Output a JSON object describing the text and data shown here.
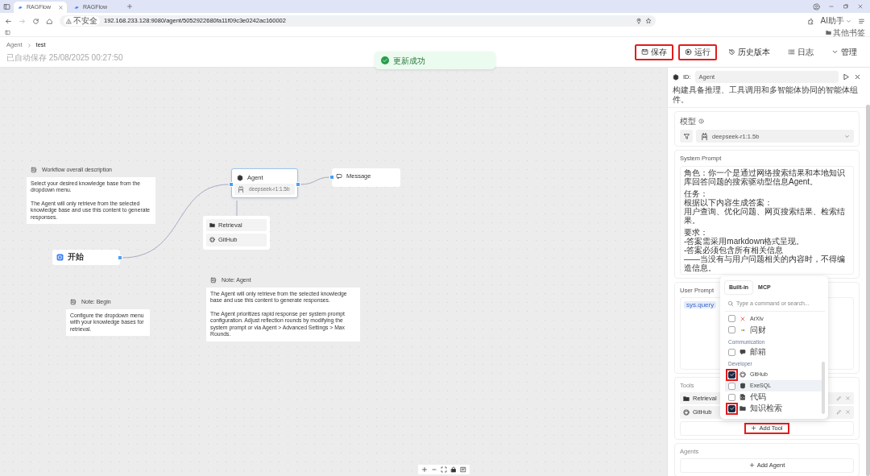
{
  "browser": {
    "tabs": [
      {
        "title": "RAGFlow",
        "selected": true
      },
      {
        "title": "RAGFlow",
        "selected": false
      }
    ],
    "security": "不安全",
    "url": "192.168.233.128:9080/agent/5052922680fa11f09c3e0242ac160002",
    "assistant": "AI助手",
    "bookmarks_folder": "其他书签"
  },
  "header": {
    "breadcrumb": [
      "Agent",
      "test"
    ],
    "saved": "已自动保存 25/08/2025 00:27:50",
    "actions": [
      {
        "label": "保存",
        "highlighted": true
      },
      {
        "label": "运行",
        "highlighted": true
      },
      {
        "label": "历史版本",
        "highlighted": false
      },
      {
        "label": "日志",
        "highlighted": false
      },
      {
        "label": "管理",
        "highlighted": false
      }
    ]
  },
  "toast": {
    "text": "更新成功"
  },
  "canvas": {
    "nodes": [
      {
        "kind": "note",
        "title": "Workflow overall description",
        "paragraphs": [
          "Select your desired knowledge base from the dropdown menu.",
          "The Agent will only retrieve from the selected knowledge base and use this content  to generate responses."
        ]
      },
      {
        "kind": "agent",
        "title": "Agent",
        "model": "deepseek-r1:1.5b"
      },
      {
        "kind": "message",
        "title": "Message"
      },
      {
        "kind": "tools",
        "items": [
          {
            "name": "Retrieval"
          },
          {
            "name": "GitHub"
          }
        ]
      },
      {
        "kind": "begin",
        "title": "开始"
      },
      {
        "kind": "note",
        "title": "Note: Agent",
        "paragraphs": [
          "The Agent will only retrieve from the selected knowledge base and use this content  to generate responses.",
          "The Agent prioritizes rapid response per system prompt configuration. Adjust reflection rounds by modifying the system prompt or via Agent > Advanced Settings > Max Rounds."
        ]
      },
      {
        "kind": "note",
        "title": "Note: Begin",
        "paragraphs": [
          "Configure the dropdown menu with your knowledge bases for retrieval."
        ]
      }
    ]
  },
  "panel": {
    "id_label": "ID:",
    "id_value": "Agent",
    "description": "构建具备推理、工具调用和多智能体协同的智能体组件。",
    "model": {
      "label": "模型",
      "name": "deepseek-r1:1.5b"
    },
    "system_prompt": {
      "label": "System Prompt",
      "paragraphs": [
        [
          "角色：你一个是通过网络搜索结果和本地知识库回答问题的搜索驱动型信息Agent。"
        ],
        [
          "任务：",
          "根据以下内容生成答案：",
          "用户查询、优化问题、网页搜索结果、检索结果。"
        ],
        [
          "要求：",
          "-答案需采用markdown格式呈现。",
          "-答案必须包含所有相关信息",
          "——当没有与用户问题相关的内容时，不得编造信息。"
        ]
      ]
    },
    "user_prompt": {
      "label": "User Prompt",
      "variable": "sys.query"
    },
    "tools": {
      "label": "Tools",
      "items": [
        {
          "name": "Retrieval"
        },
        {
          "name": "GitHub"
        }
      ],
      "add": "Add Tool",
      "add_highlighted": true
    },
    "agents": {
      "label": "Agents",
      "add": "Add Agent"
    }
  },
  "tool_popup": {
    "tabs": [
      {
        "label": "Built-in",
        "selected": true
      },
      {
        "label": "MCP",
        "selected": false
      }
    ],
    "placeholder": "Type a command or search...",
    "sections": [
      {
        "items": [
          {
            "name": "ArXiv",
            "checked": false,
            "highlighted": false,
            "hovered": false
          },
          {
            "name": "问财",
            "checked": false,
            "highlighted": false,
            "hovered": false
          }
        ]
      },
      {
        "title": "Communication",
        "items": [
          {
            "name": "邮箱",
            "checked": false,
            "highlighted": false,
            "hovered": false
          }
        ]
      },
      {
        "title": "Developer",
        "items": [
          {
            "name": "GitHub",
            "checked": true,
            "highlighted": true,
            "hovered": false
          },
          {
            "name": "ExeSQL",
            "checked": false,
            "highlighted": false,
            "hovered": true
          },
          {
            "name": "代码",
            "checked": false,
            "highlighted": false,
            "hovered": false
          },
          {
            "name": "知识检索",
            "checked": true,
            "highlighted": true,
            "hovered": false
          }
        ]
      }
    ]
  }
}
